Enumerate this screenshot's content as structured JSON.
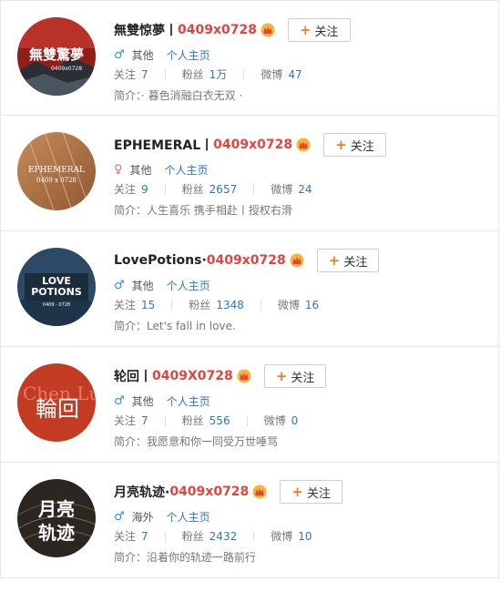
{
  "common": {
    "follow_label": "关注",
    "homepage_label": "个人主页",
    "follows_label": "关注",
    "fans_label": "粉丝",
    "weibo_label": "微博",
    "bio_prefix": "简介：",
    "follow_icon": "plus-icon",
    "crown_icon": "crown-icon"
  },
  "users": [
    {
      "name": "無雙惊夢丨",
      "suffix": "0409x0728",
      "gender": "male",
      "gender_symbol": "♂",
      "region": "其他",
      "follows": "7",
      "fans": "1万",
      "weibo": "47",
      "bio": "· 暮色消融白衣无双 ·",
      "avatar_text": "無雙驚夢",
      "avatar_subtext": "0409x0728"
    },
    {
      "name": "EPHEMERAL丨",
      "suffix": "0409x0728",
      "gender": "female",
      "gender_symbol": "♀",
      "region": "其他",
      "follows": "9",
      "fans": "2657",
      "weibo": "24",
      "bio": "人生喜乐 携手相赴丨授权右滑",
      "avatar_text": "EPHEMERAL",
      "avatar_subtext": "0409 x 0728"
    },
    {
      "name": "LovePotions·",
      "suffix": "0409x0728",
      "gender": "male",
      "gender_symbol": "♂",
      "region": "其他",
      "follows": "15",
      "fans": "1348",
      "weibo": "16",
      "bio": "Let's fall in love.",
      "avatar_text": "LOVE",
      "avatar_text2": "POTIONS",
      "avatar_subtext": "0409 · 0728"
    },
    {
      "name": "轮回丨",
      "suffix": "0409X0728",
      "gender": "male",
      "gender_symbol": "♂",
      "region": "其他",
      "follows": "7",
      "fans": "556",
      "weibo": "0",
      "bio": "我愿意和你一同受万世唾骂",
      "avatar_text": "輪回",
      "avatar_bg_text": "Chen Lu"
    },
    {
      "name": "月亮轨迹·",
      "suffix": "0409x0728",
      "gender": "male",
      "gender_symbol": "♂",
      "region": "海外",
      "follows": "7",
      "fans": "2432",
      "weibo": "10",
      "bio": "沿着你的轨迹一路前行",
      "avatar_text": "月亮",
      "avatar_text2": "轨迹"
    }
  ]
}
